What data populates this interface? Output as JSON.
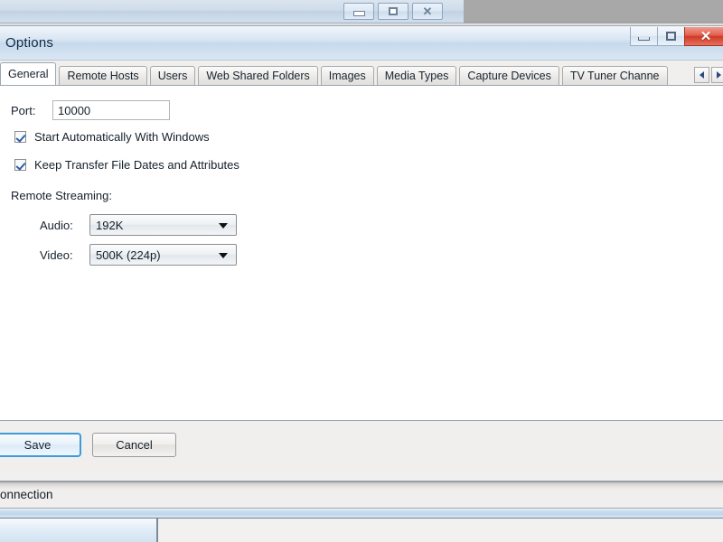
{
  "desktop": {
    "parent_window": {
      "buttons": [
        {
          "name": "minimize",
          "glyph": "minimize-icon"
        },
        {
          "name": "maximize",
          "glyph": "maximize-icon"
        },
        {
          "name": "close",
          "glyph": "close-icon"
        }
      ]
    },
    "background_label": "onnection"
  },
  "dialog": {
    "title": "Options",
    "titlebar_buttons": {
      "minimize": "minimize-icon",
      "maximize": "maximize-icon",
      "close_glyph": "✕"
    },
    "tabs": [
      {
        "label": "General",
        "active": true
      },
      {
        "label": "Remote Hosts",
        "active": false
      },
      {
        "label": "Users",
        "active": false
      },
      {
        "label": "Web Shared Folders",
        "active": false
      },
      {
        "label": "Images",
        "active": false
      },
      {
        "label": "Media Types",
        "active": false
      },
      {
        "label": "Capture Devices",
        "active": false
      },
      {
        "label": "TV Tuner Channe",
        "active": false
      }
    ],
    "tab_scroll": {
      "left_icon": "chevron-left-icon",
      "right_icon": "chevron-right-icon"
    },
    "general": {
      "port_label": "Port:",
      "port_value": "10000",
      "checkbox_start": {
        "label": "Start Automatically With Windows",
        "checked": true
      },
      "checkbox_keep": {
        "label": "Keep Transfer File Dates and Attributes",
        "checked": true
      },
      "remote_streaming_title": "Remote Streaming:",
      "audio_label": "Audio:",
      "audio_value": "192K",
      "video_label": "Video:",
      "video_value": "500K (224p)"
    },
    "footer": {
      "save_label": "Save",
      "cancel_label": "Cancel"
    },
    "colors": {
      "focus_border": "#3c9bd8",
      "close_button": "#cf3a26",
      "title_bar": "#c6d9ec",
      "checkmark": "#2f5fa8"
    }
  }
}
